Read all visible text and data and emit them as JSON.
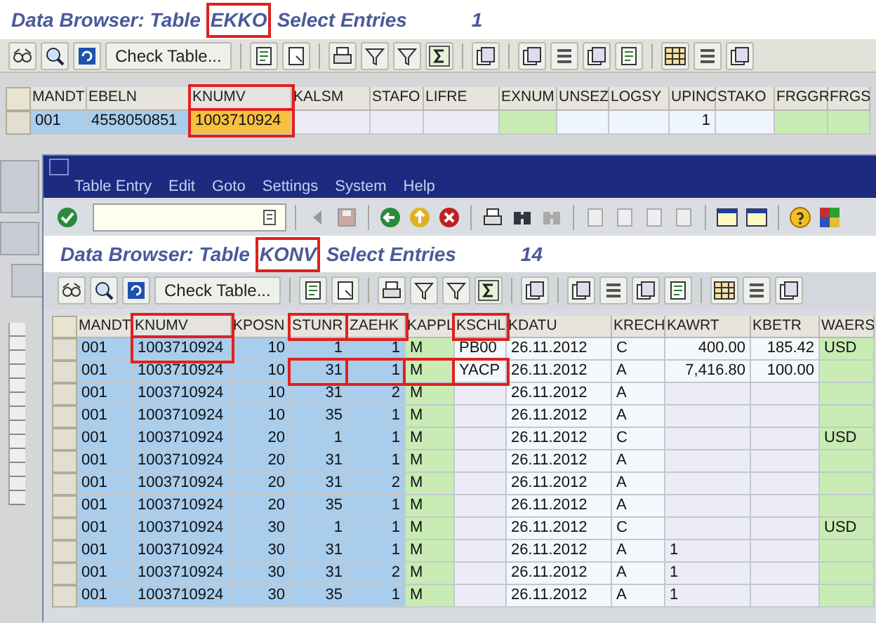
{
  "main_title": {
    "prefix": "Data Browser: Table",
    "table": "EKKO",
    "table_highlight": true,
    "suffix": "Select Entries",
    "count": "1"
  },
  "main_toolbar": {
    "button": "Check Table..."
  },
  "header_table": {
    "columns": [
      {
        "label": "MANDT",
        "highlight": false
      },
      {
        "label": "EBELN",
        "highlight": false
      },
      {
        "label": "KNUMV",
        "highlight": true
      },
      {
        "label": "KALSM",
        "highlight": false
      },
      {
        "label": "STAFO",
        "highlight": false
      },
      {
        "label": "LIFRE",
        "highlight": false
      },
      {
        "label": "EXNUM",
        "highlight": false
      },
      {
        "label": "UNSEZ",
        "highlight": false
      },
      {
        "label": "LOGSY",
        "highlight": false
      },
      {
        "label": "UPINC",
        "highlight": false
      },
      {
        "label": "STAKO",
        "highlight": false
      },
      {
        "label": "FRGGR",
        "highlight": false
      },
      {
        "label": "FRGS",
        "highlight": false
      }
    ],
    "rows": [
      {
        "cells": [
          "001",
          "4558050851",
          {
            "text": "1003710924",
            "highlight": true
          },
          null,
          null,
          null,
          null,
          null,
          null,
          "1",
          null,
          null,
          null
        ]
      }
    ]
  },
  "window": {
    "menu": [
      "Table Entry",
      "Edit",
      "Goto",
      "Settings",
      "System",
      "Help"
    ],
    "title": {
      "prefix": "Data Browser: Table",
      "table": "KONV",
      "table_highlight": true,
      "suffix": "Select Entries",
      "count": "14"
    },
    "toolbar": {
      "button": "Check Table..."
    },
    "table": {
      "columns": [
        {
          "label": "MANDT",
          "highlight": false
        },
        {
          "label": "KNUMV",
          "highlight": true
        },
        {
          "label": "KPOSN",
          "highlight": false
        },
        {
          "label": "STUNR",
          "highlight": true
        },
        {
          "label": "ZAEHK",
          "highlight": true
        },
        {
          "label": "KAPPL",
          "highlight": false
        },
        {
          "label": "KSCHL",
          "highlight": true
        },
        {
          "label": "KDATU",
          "highlight": false
        },
        {
          "label": "KRECH",
          "highlight": false
        },
        {
          "label": "KAWRT",
          "highlight": false
        },
        {
          "label": "KBETR",
          "highlight": false
        },
        {
          "label": "WAERS",
          "highlight": false
        }
      ],
      "rows": [
        {
          "cells": [
            "001",
            {
              "text": "1003710924",
              "highlight": true
            },
            "10",
            "1",
            "1",
            "M",
            "PB00",
            "26.11.2012",
            "C",
            "400.00",
            "185.42",
            "USD"
          ]
        },
        {
          "cells": [
            "001",
            "1003710924",
            "10",
            {
              "text": "31",
              "highlight": true
            },
            {
              "text": "1",
              "highlight": true
            },
            {
              "text": "M",
              "highlight": true
            },
            {
              "text": "YACP",
              "highlight": true
            },
            "26.11.2012",
            "A",
            "7,416.80",
            "100.00",
            null
          ]
        },
        {
          "cells": [
            "001",
            "1003710924",
            "10",
            "31",
            "2",
            "M",
            {
              "masked": true
            },
            "26.11.2012",
            "A",
            {
              "masked": true
            },
            {
              "masked": true
            },
            null
          ]
        },
        {
          "cells": [
            "001",
            "1003710924",
            "10",
            "35",
            "1",
            "M",
            {
              "masked": true
            },
            "26.11.2012",
            "A",
            {
              "masked": true
            },
            {
              "masked": true
            },
            null
          ]
        },
        {
          "cells": [
            "001",
            "1003710924",
            "20",
            "1",
            "1",
            "M",
            {
              "masked": true
            },
            "26.11.2012",
            "C",
            {
              "masked": true
            },
            {
              "masked": true
            },
            "USD"
          ]
        },
        {
          "cells": [
            "001",
            "1003710924",
            "20",
            "31",
            "1",
            "M",
            {
              "masked": true
            },
            "26.11.2012",
            "A",
            {
              "masked": true
            },
            {
              "masked": true
            },
            null
          ]
        },
        {
          "cells": [
            "001",
            "1003710924",
            "20",
            "31",
            "2",
            "M",
            {
              "masked": true
            },
            "26.11.2012",
            "A",
            {
              "masked": true
            },
            {
              "masked": true
            },
            null
          ]
        },
        {
          "cells": [
            "001",
            "1003710924",
            "20",
            "35",
            "1",
            "M",
            {
              "masked": true
            },
            "26.11.2012",
            "A",
            {
              "masked": true
            },
            {
              "masked": true
            },
            null
          ]
        },
        {
          "cells": [
            "001",
            "1003710924",
            "30",
            "1",
            "1",
            "M",
            {
              "masked": true
            },
            "26.11.2012",
            "C",
            {
              "masked": true
            },
            {
              "masked": true
            },
            "USD"
          ]
        },
        {
          "cells": [
            "001",
            "1003710924",
            "30",
            "31",
            "1",
            "M",
            {
              "masked": true
            },
            "26.11.2012",
            "A",
            {
              "text": "1",
              "masked": true
            },
            {
              "masked": true
            },
            null
          ]
        },
        {
          "cells": [
            "001",
            "1003710924",
            "30",
            "31",
            "2",
            "M",
            {
              "masked": true
            },
            "26.11.2012",
            "A",
            {
              "text": "1",
              "masked": true
            },
            {
              "masked": true
            },
            null
          ]
        },
        {
          "cells": [
            "001",
            "1003710924",
            "30",
            "35",
            "1",
            "M",
            {
              "masked": true
            },
            "26.11.2012",
            "A",
            {
              "text": "1",
              "masked": true
            },
            {
              "masked": true
            },
            null
          ]
        }
      ]
    }
  }
}
